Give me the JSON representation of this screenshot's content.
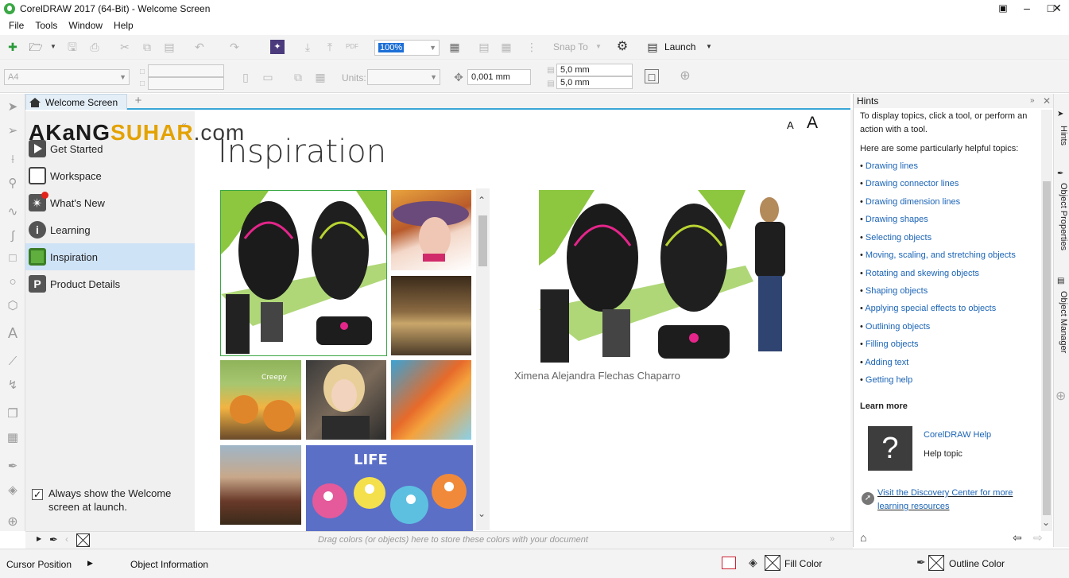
{
  "window": {
    "title": "CorelDRAW 2017 (64-Bit) - Welcome Screen"
  },
  "menu": [
    "File",
    "Tools",
    "Window",
    "Help"
  ],
  "toolbar": {
    "zoom_value": "100%",
    "snap_label": "Snap To",
    "launch_label": "Launch"
  },
  "propbar": {
    "page_size": "A4",
    "units_label": "Units:",
    "nudge_value": "0,001 mm",
    "dup_x": "5,0 mm",
    "dup_y": "5,0 mm"
  },
  "tabs": {
    "welcome": "Welcome Screen"
  },
  "watermark": "AKaNGSUHAR.com",
  "nav": {
    "items": [
      "Get Started",
      "Workspace",
      "What's New",
      "Learning",
      "Inspiration",
      "Product Details"
    ],
    "selected": "Inspiration",
    "checkbox_label_1": "Always show the Welcome",
    "checkbox_label_2": "screen at launch."
  },
  "main": {
    "title": "Inspiration",
    "font_small": "A",
    "font_large": "A",
    "caption": "Ximena Alejandra Flechas Chaparro"
  },
  "hints": {
    "header": "Hints",
    "intro": "To display topics, click a tool, or perform an action with a tool.",
    "helpful": "Here are some particularly helpful topics:",
    "topics": [
      "Drawing lines",
      "Drawing connector lines",
      "Drawing dimension lines",
      "Drawing shapes",
      "Selecting objects",
      "Moving, scaling, and stretching objects",
      "Rotating and skewing objects",
      "Shaping objects",
      "Applying special effects to objects",
      "Outlining objects",
      "Filling objects",
      "Adding text",
      "Getting help"
    ],
    "learn_more": "Learn more",
    "help_title": "CorelDRAW Help",
    "help_sub": "Help topic",
    "discovery": "Visit the Discovery Center for more learning resources"
  },
  "dock_tabs": [
    "Hints",
    "Object Properties",
    "Object Manager"
  ],
  "palette": {
    "hint": "Drag colors (or objects) here to store these colors with your document"
  },
  "status": {
    "cursor_position": "Cursor Position",
    "object_information": "Object Information",
    "fill_color": "Fill Color",
    "outline_color": "Outline Color"
  },
  "colors": {
    "accent": "#3aa6d8",
    "brand_green": "#3aa845",
    "nav_selected": "#cfe3f7",
    "link": "#1b64b6"
  }
}
